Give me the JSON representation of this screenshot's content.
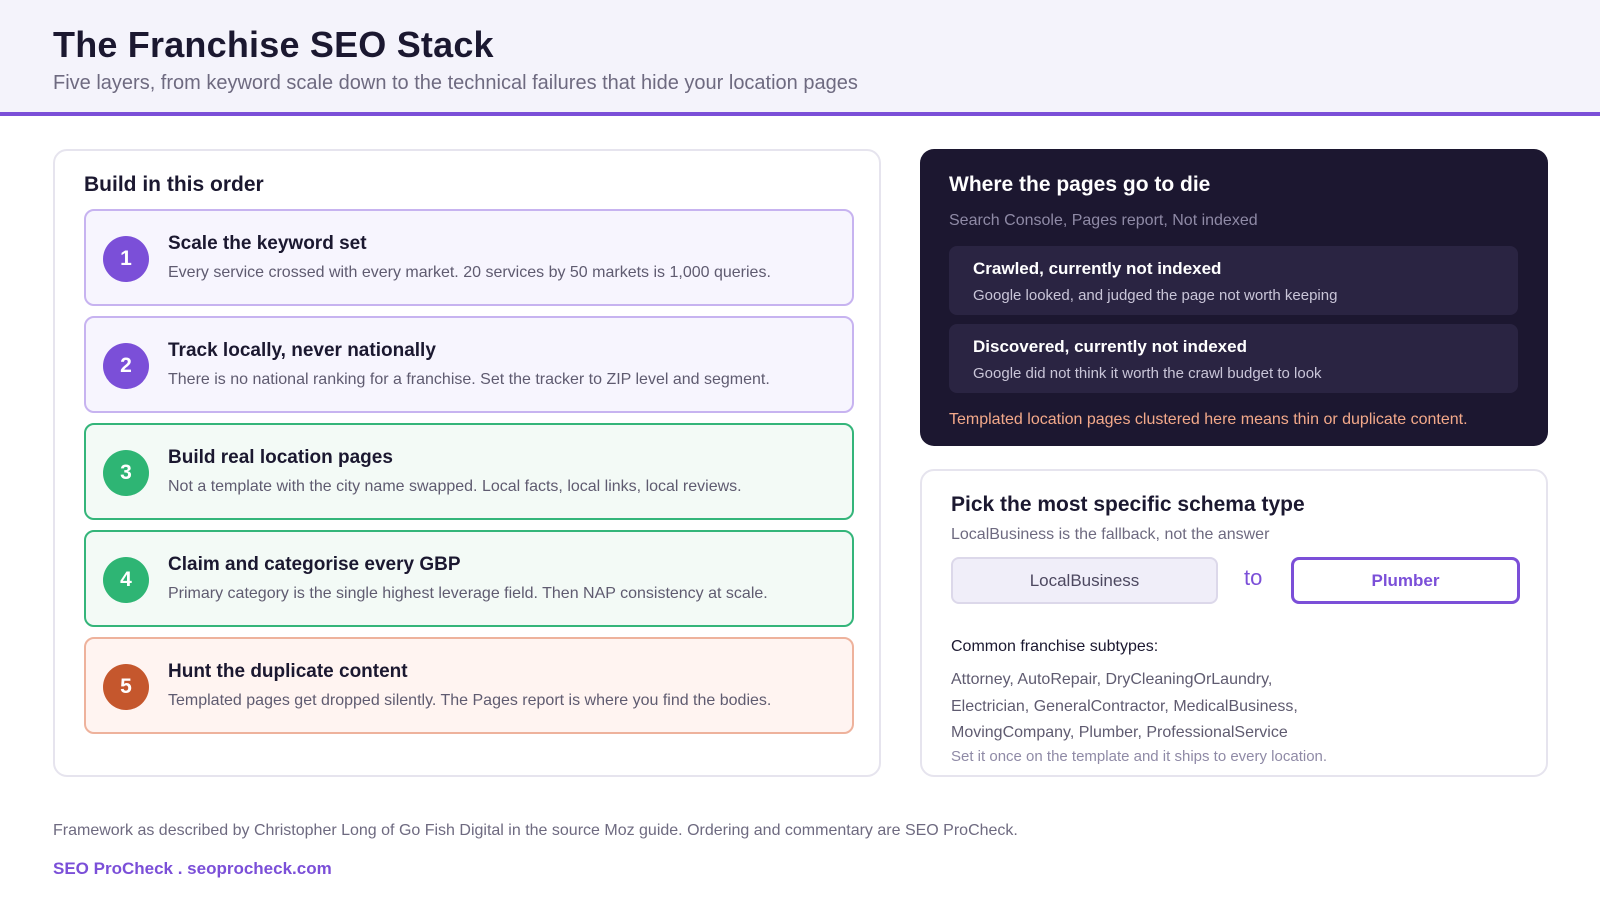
{
  "header": {
    "title": "The Franchise SEO Stack",
    "subtitle": "Five layers, from keyword scale down to the technical failures that hide your location pages"
  },
  "build_order": {
    "title": "Build in this order",
    "steps": [
      {
        "number": "1",
        "title": "Scale the keyword set",
        "description": "Every service crossed with every market. 20 services by 50 markets is 1,000 queries.",
        "color": "#7b4fd8"
      },
      {
        "number": "2",
        "title": "Track locally, never nationally",
        "description": "There is no national ranking for a franchise. Set the tracker to ZIP level and segment.",
        "color": "#7b4fd8"
      },
      {
        "number": "3",
        "title": "Build real location pages",
        "description": "Not a template with the city name swapped. Local facts, local links, local reviews.",
        "color": "#2eb574"
      },
      {
        "number": "4",
        "title": "Claim and categorise every GBP",
        "description": "Primary category is the single highest leverage field. Then NAP consistency at scale.",
        "color": "#2eb574"
      },
      {
        "number": "5",
        "title": "Hunt the duplicate content",
        "description": "Templated pages get dropped silently. The Pages report is where you find the bodies.",
        "color": "#c5572d"
      }
    ]
  },
  "pages_die": {
    "title": "Where the pages go to die",
    "subtitle": "Search Console, Pages report, Not indexed",
    "cards": [
      {
        "title": "Crawled, currently not indexed",
        "description": "Google looked, and judged the page not worth keeping"
      },
      {
        "title": "Discovered, currently not indexed",
        "description": "Google did not think it worth the crawl budget to look"
      }
    ],
    "warning": "Templated location pages clustered here means thin or duplicate content."
  },
  "schema": {
    "title": "Pick the most specific schema type",
    "subtitle": "LocalBusiness is the fallback, not the answer",
    "from": "LocalBusiness",
    "to_word": "to",
    "to": "Plumber",
    "subtypes_label": "Common franchise subtypes:",
    "subtypes_lines": [
      "Attorney, AutoRepair, DryCleaningOrLaundry,",
      "Electrician, GeneralContractor, MedicalBusiness,",
      "MovingCompany, Plumber, ProfessionalService"
    ],
    "footnote": "Set it once on the template and it ships to every location."
  },
  "footer": {
    "note": "Framework as described by Christopher Long of Go Fish Digital in the source Moz guide. Ordering and commentary are SEO ProCheck.",
    "brand": "SEO ProCheck . seoprocheck.com"
  },
  "colors": {
    "accent": "#7b4fd8",
    "green": "#2eb574",
    "orange": "#c5572d",
    "dark_panel": "#1c1730"
  }
}
